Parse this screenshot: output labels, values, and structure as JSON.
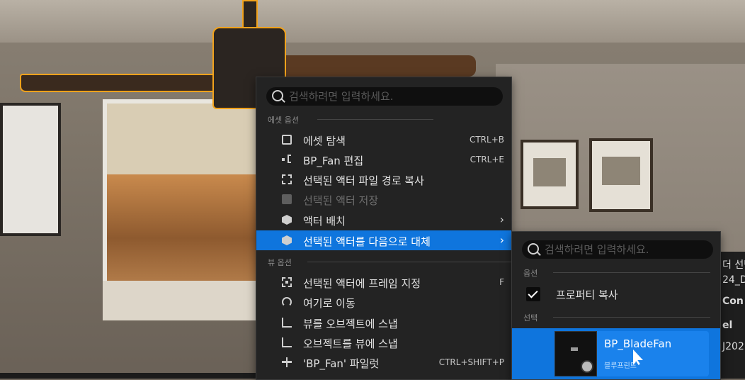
{
  "main_menu": {
    "search_placeholder": "검색하려면 입력하세요.",
    "sections": [
      {
        "title": "에셋 옵션",
        "items": [
          {
            "label": "에셋 탐색",
            "shortcut": "CTRL+B",
            "icon": "folder-search-icon",
            "enabled": true
          },
          {
            "label": "BP_Fan 편집",
            "shortcut": "CTRL+E",
            "icon": "blueprint-nodes-icon",
            "enabled": true
          },
          {
            "label": "선택된 액터 파일 경로 복사",
            "shortcut": "",
            "icon": "copy-path-icon",
            "enabled": true
          },
          {
            "label": "선택된 액터 저장",
            "shortcut": "",
            "icon": "save-icon",
            "enabled": false
          },
          {
            "label": "액터 배치",
            "shortcut": "",
            "icon": "place-actor-icon",
            "enabled": true,
            "submenu": true
          },
          {
            "label": "선택된 액터를 다음으로 대체",
            "shortcut": "",
            "icon": "replace-actor-icon",
            "enabled": true,
            "submenu": true,
            "highlighted": true
          }
        ]
      },
      {
        "title": "뷰 옵션",
        "items": [
          {
            "label": "선택된 액터에 프레임 지정",
            "shortcut": "F",
            "icon": "frame-selection-icon",
            "enabled": true
          },
          {
            "label": "여기로 이동",
            "shortcut": "",
            "icon": "move-here-icon",
            "enabled": true
          },
          {
            "label": "뷰를 오브젝트에 스냅",
            "shortcut": "",
            "icon": "snap-view-icon",
            "enabled": true
          },
          {
            "label": "오브젝트를 뷰에 스냅",
            "shortcut": "",
            "icon": "snap-object-icon",
            "enabled": true
          },
          {
            "label": "'BP_Fan' 파일럿",
            "shortcut": "CTRL+SHIFT+P",
            "icon": "pilot-icon",
            "enabled": true
          }
        ]
      }
    ]
  },
  "sub_menu": {
    "search_placeholder": "검색하려면 입력하세요.",
    "options_title": "옵션",
    "copy_properties_label": "프로퍼티 복사",
    "copy_properties_checked": true,
    "selection_title": "선택",
    "asset": {
      "name": "BP_BladeFan",
      "type": "블루프린트"
    }
  },
  "right_panel_peek": [
    "더 선택",
    "24_D",
    "Con",
    "el",
    "J202"
  ],
  "colors": {
    "highlight": "#0f75dd",
    "menu_bg": "#232323",
    "selection_outline": "#f1a21c"
  }
}
